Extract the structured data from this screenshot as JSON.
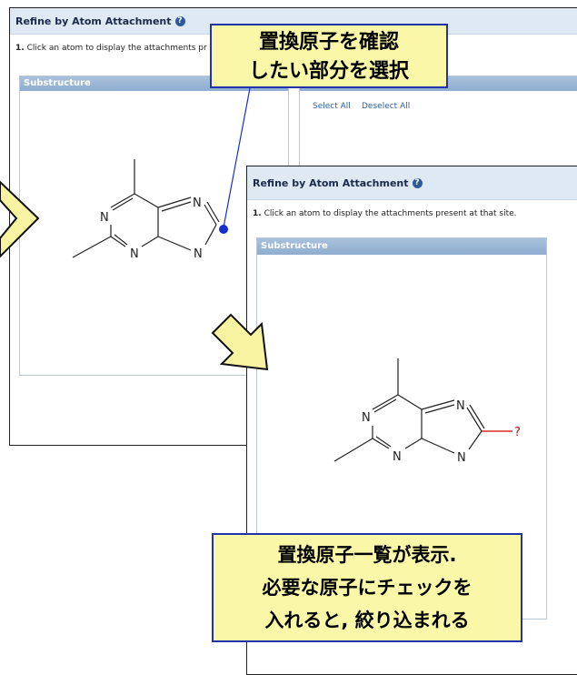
{
  "back_panel": {
    "title": "Refine by Atom Attachment",
    "help_icon": "question-circle-icon",
    "instruction_step": "1.",
    "instruction_text": "Click an atom to display the attachments pr",
    "substructure_label": "Substructure",
    "select_all": "Select All",
    "deselect_all": "Deselect All"
  },
  "front_panel": {
    "title": "Refine by Atom Attachment",
    "help_icon": "question-circle-icon",
    "instruction_step": "1.",
    "instruction_text": "Click an atom to display the attachments present at that site.",
    "substructure_label": "Substructure",
    "attachment_marker": "?"
  },
  "atoms": {
    "n": "N"
  },
  "callouts": {
    "top_line1": "置換原子を確認",
    "top_line2": "したい部分を選択",
    "bottom_line1": "置換原子一覧が表示.",
    "bottom_line2": "必要な原子にチェックを",
    "bottom_line3": "入れると, 絞り込まれる"
  },
  "colors": {
    "header_bg": "#dfe9f3",
    "box_header": "#9ab6d6",
    "callout_bg": "#fbf7a8",
    "callout_border": "#2233aa",
    "arrow_fill": "#f7f3a0",
    "selection_dot": "#1a2ed0",
    "attachment_bond": "#d40000"
  }
}
